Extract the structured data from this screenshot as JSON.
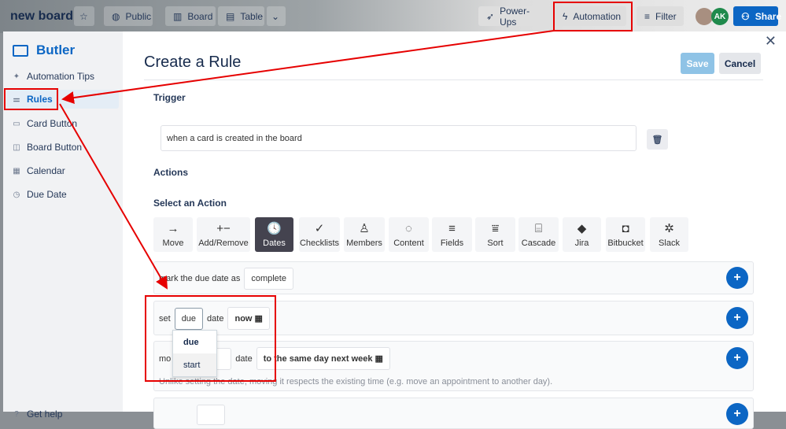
{
  "board": {
    "title": "new board",
    "visibility": "Public",
    "views": [
      "Board",
      "Table"
    ],
    "power_ups": "Power-Ups",
    "automation": "Automation",
    "filter": "Filter",
    "share": "Share",
    "avatar_initials": "AK"
  },
  "sidebar": {
    "title": "Butler",
    "items": [
      {
        "label": "Automation Tips"
      },
      {
        "label": "Rules"
      },
      {
        "label": "Card Button"
      },
      {
        "label": "Board Button"
      },
      {
        "label": "Calendar"
      },
      {
        "label": "Due Date"
      }
    ],
    "help": "Get help"
  },
  "main": {
    "title": "Create a Rule",
    "save": "Save",
    "cancel": "Cancel",
    "trigger_label": "Trigger",
    "trigger_value": "when a card is created in the board",
    "actions_label": "Actions",
    "select_action_label": "Select an Action",
    "action_types": [
      {
        "label": "Move",
        "icon": "→"
      },
      {
        "label": "Add/Remove",
        "icon": "+−"
      },
      {
        "label": "Dates",
        "icon": "🕓"
      },
      {
        "label": "Checklists",
        "icon": "✓"
      },
      {
        "label": "Members",
        "icon": "♙"
      },
      {
        "label": "Content",
        "icon": "◌"
      },
      {
        "label": "Fields",
        "icon": "≡"
      },
      {
        "label": "Sort",
        "icon": "⩸"
      },
      {
        "label": "Cascade",
        "icon": "⌸"
      },
      {
        "label": "Jira",
        "icon": "◆"
      },
      {
        "label": "Bitbucket",
        "icon": "◘"
      },
      {
        "label": "Slack",
        "icon": "✲"
      }
    ],
    "rows": {
      "mark": {
        "text": "mark the due date as",
        "value": "complete"
      },
      "set": {
        "text": "set",
        "field": "due",
        "text2": "date",
        "value": "now"
      },
      "move": {
        "text": "mo",
        "text2": "date",
        "value": "to the same day next week",
        "hint": "Unlike setting the date, moving it respects the existing time (e.g. move an appointment to another day)."
      }
    },
    "dropdown": {
      "options": [
        "due",
        "start"
      ]
    }
  },
  "colors": {
    "primary": "#0c66c4",
    "annotation": "#e60000"
  }
}
